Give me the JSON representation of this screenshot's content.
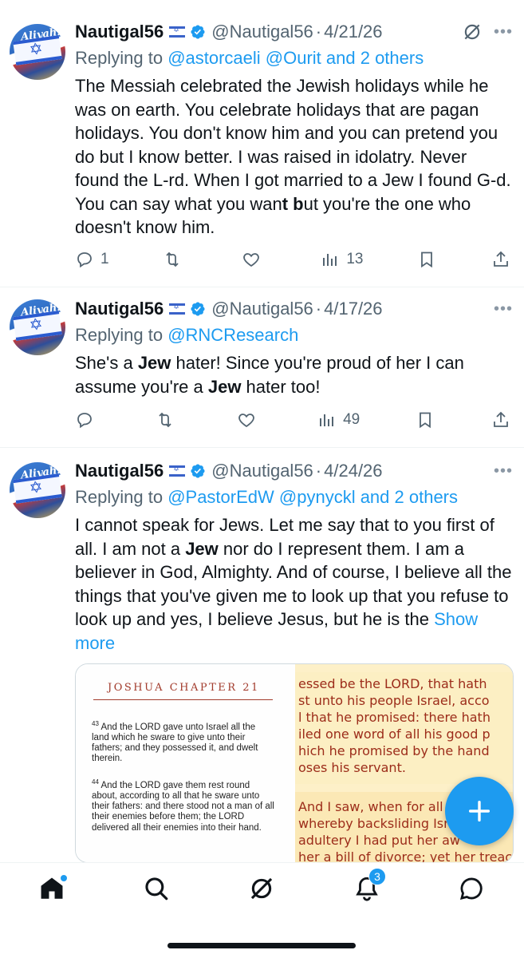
{
  "tweets": [
    {
      "name": "Nautigal56",
      "handle": "@Nautigal56",
      "date": "4/21/26",
      "replying_prefix": "Replying to ",
      "replying_targets": "@astorcaeli @Ourit and 2 others",
      "body": [
        {
          "t": "The Messiah celebrated the Jewish holidays while he was on earth. You celebrate holidays that are pagan holidays. You don't know him and you can pretend you do but I know better. I was raised in idolatry. Never found the L-rd. When I got married to a Jew I found G-d. You can say what you wan"
        },
        {
          "t": "t b",
          "bold": true
        },
        {
          "t": "ut you're the one who doesn't know him."
        }
      ],
      "replies": "1",
      "reposts": "",
      "likes": "",
      "views": "13",
      "has_grok_icon": true
    },
    {
      "name": "Nautigal56",
      "handle": "@Nautigal56",
      "date": "4/17/26",
      "replying_prefix": "Replying to ",
      "replying_targets": "@RNCResearch",
      "body": [
        {
          "t": "She's a "
        },
        {
          "t": "Jew",
          "bold": true
        },
        {
          "t": " hater! Since you're proud of her I can assume you're a "
        },
        {
          "t": "Jew",
          "bold": true
        },
        {
          "t": " hater too!"
        }
      ],
      "replies": "",
      "reposts": "",
      "likes": "",
      "views": "49",
      "has_grok_icon": false
    },
    {
      "name": "Nautigal56",
      "handle": "@Nautigal56",
      "date": "4/24/26",
      "replying_prefix": "Replying to ",
      "replying_targets": "@PastorEdW @pynyckl and 2 others",
      "body": [
        {
          "t": "I cannot speak for Jews. Let me say that to you first of all. I am not a "
        },
        {
          "t": "Jew",
          "bold": true
        },
        {
          "t": " nor do I represent them. I am a believer in God, Almighty. And of course, I believe all the things that you've given me to look up that you refuse to look up and yes, I believe Jesus, but he is the "
        }
      ],
      "show_more": "Show more",
      "has_grok_icon": false
    }
  ],
  "media": {
    "left_title": "JOSHUA CHAPTER 21",
    "verse43_num": "43",
    "verse43": "And the LORD gave unto Israel all the land which he sware to give unto their fathers; and they possessed it, and dwelt therein.",
    "verse44_num": "44",
    "verse44": "And the LORD gave them rest round about, according to all that he sware unto their fathers: and there stood not a man of all their enemies before them; the LORD delivered all their enemies into their hand.",
    "right_lines": [
      "essed be the LORD, that hath",
      "st unto his people Israel, acco",
      "l that he promised: there hath",
      "iled one word of all his good p",
      "hich he promised by the hand",
      "oses his servant."
    ],
    "right_lines2": [
      "And I saw, when for all",
      "whereby backsliding Isr",
      "adultery I had put her aw",
      "her a bill of divorce; yet her treac"
    ]
  },
  "fab_label": "compose",
  "tabbar": {
    "notifications_badge": "3"
  },
  "colors": {
    "accent": "#1d9bf0",
    "text": "#0f1419",
    "muted": "#536471"
  }
}
